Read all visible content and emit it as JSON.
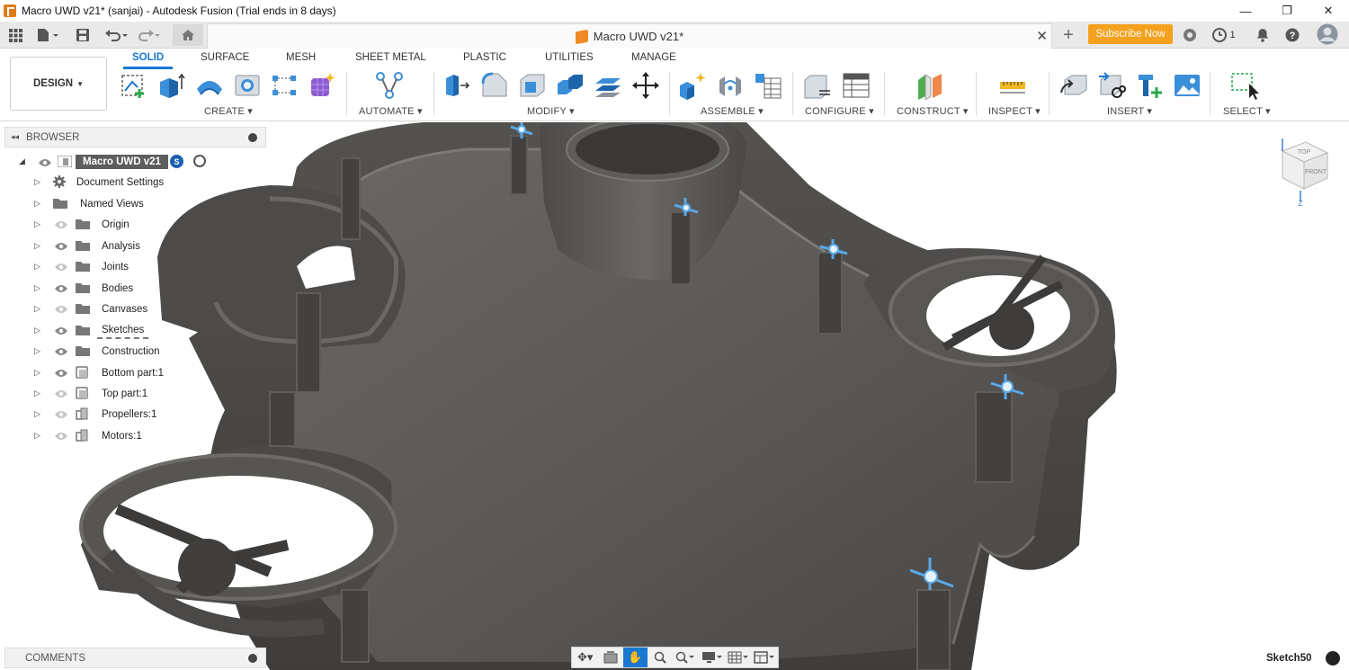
{
  "window": {
    "title": "Macro UWD v21* (sanjai) - Autodesk Fusion (Trial ends in 8 days)",
    "controls": [
      "—",
      "❐",
      "✕"
    ]
  },
  "quick_access": {
    "icons": [
      "grid-icon",
      "file-icon",
      "save-icon",
      "undo-icon",
      "redo-icon",
      "home-icon"
    ],
    "doc_tab_label": "Macro UWD v21*",
    "subscribe_label": "Subscribe Now",
    "job_count": "1"
  },
  "toolbar": {
    "workspace": "DESIGN",
    "tabs": [
      "SOLID",
      "SURFACE",
      "MESH",
      "SHEET METAL",
      "PLASTIC",
      "UTILITIES",
      "MANAGE"
    ],
    "active_tab": "SOLID",
    "groups": [
      "CREATE",
      "AUTOMATE",
      "MODIFY",
      "ASSEMBLE",
      "CONFIGURE",
      "CONSTRUCT",
      "INSPECT",
      "INSERT",
      "SELECT"
    ]
  },
  "browser": {
    "title": "BROWSER",
    "root": "Macro UWD v21",
    "root_badge": "S",
    "items": [
      {
        "label": "Document Settings",
        "icon": "gear-icon"
      },
      {
        "label": "Named Views",
        "icon": "folder-icon"
      },
      {
        "label": "Origin",
        "icon": "folder-icon"
      },
      {
        "label": "Analysis",
        "icon": "folder-icon"
      },
      {
        "label": "Joints",
        "icon": "folder-icon"
      },
      {
        "label": "Bodies",
        "icon": "folder-icon"
      },
      {
        "label": "Canvases",
        "icon": "folder-icon"
      },
      {
        "label": "Sketches",
        "icon": "folder-icon"
      },
      {
        "label": "Construction",
        "icon": "folder-icon"
      },
      {
        "label": "Bottom part:1",
        "icon": "component-icon"
      },
      {
        "label": "Top part:1",
        "icon": "component-icon"
      },
      {
        "label": "Propellers:1",
        "icon": "assembly-icon"
      },
      {
        "label": "Motors:1",
        "icon": "assembly-icon"
      }
    ]
  },
  "viewcube": {
    "top": "TOP",
    "front": "FRONT",
    "axis": "Z"
  },
  "comments": {
    "title": "COMMENTS"
  },
  "status": {
    "sketch_label": "Sketch50"
  },
  "colors": {
    "accent": "#1a77d2",
    "subscribe": "#f4a11d",
    "model": "#5a5856"
  }
}
